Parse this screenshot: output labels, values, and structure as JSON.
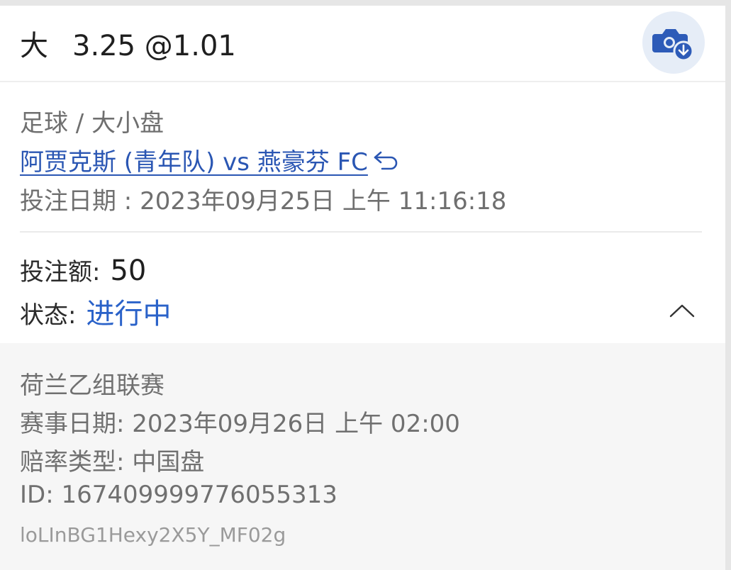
{
  "bet": {
    "selection": "大",
    "line": "3.25",
    "odds": "@1.01"
  },
  "sport_market": "足球 / 大小盘",
  "match": {
    "teams": "阿贾克斯 (青年队) vs 燕豪芬 FC"
  },
  "bet_date": "投注日期 : 2023年09月25日 上午 11:16:18",
  "stake": {
    "label": "投注额:",
    "value": "50"
  },
  "status": {
    "label": "状态:",
    "value": "进行中"
  },
  "details": {
    "league": "荷兰乙组联赛",
    "event_date": "赛事日期: 2023年09月26日 上午 02:00",
    "odds_type": "赔率类型: 中国盘",
    "id": "ID: 1674099997760553​13",
    "code": "loLInBG1Hexy2X5Y_MF02g"
  },
  "icons": {
    "camera": "camera-download-icon",
    "back": "return-arrow-icon",
    "collapse": "chevron-up-icon"
  },
  "colors": {
    "accent": "#2a62c9",
    "link": "#2a56b3",
    "icon_bg": "#e6edf7"
  }
}
